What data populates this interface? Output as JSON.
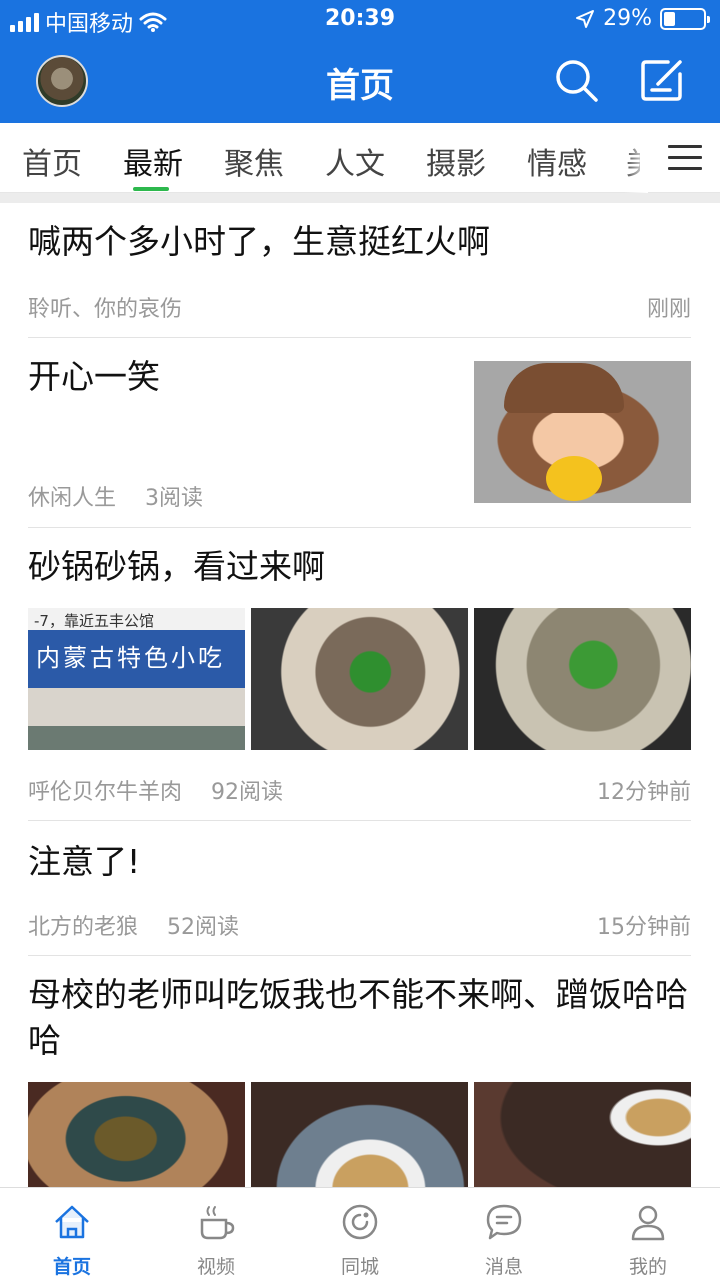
{
  "status_bar": {
    "carrier": "中国移动",
    "time": "20:39",
    "battery": "29%",
    "battery_level": 0.29
  },
  "header": {
    "title": "首页"
  },
  "tabs": [
    {
      "label": "首页"
    },
    {
      "label": "最新",
      "active": true
    },
    {
      "label": "聚焦"
    },
    {
      "label": "人文"
    },
    {
      "label": "摄影"
    },
    {
      "label": "情感"
    },
    {
      "label": "美"
    }
  ],
  "posts": [
    {
      "title": "喊两个多小时了，生意挺红火啊",
      "source": "聆听、你的哀伤",
      "reads": "",
      "time": "刚刚"
    },
    {
      "title": "开心一笑",
      "source": "休闲人生",
      "reads": "3阅读",
      "time": ""
    },
    {
      "title": "砂锅砂锅，看过来啊",
      "source": "呼伦贝尔牛羊肉",
      "reads": "92阅读",
      "time": "12分钟前",
      "shop_sign": "内蒙古特色小吃",
      "shop_note": "-7，靠近五丰公馆"
    },
    {
      "title": "注意了!",
      "source": "北方的老狼",
      "reads": "52阅读",
      "time": "15分钟前"
    },
    {
      "title": "母校的老师叫吃饭我也不能不来啊、蹭饭哈哈哈",
      "source": "",
      "reads": "",
      "time": ""
    }
  ],
  "bottom_nav": [
    {
      "label": "首页",
      "icon": "home-icon",
      "active": true
    },
    {
      "label": "视频",
      "icon": "video-cup-icon"
    },
    {
      "label": "同城",
      "icon": "location-circle-icon"
    },
    {
      "label": "消息",
      "icon": "message-icon"
    },
    {
      "label": "我的",
      "icon": "profile-icon"
    }
  ],
  "colors": {
    "brand_blue": "#1a73e0",
    "tab_indicator": "#2db84d"
  }
}
